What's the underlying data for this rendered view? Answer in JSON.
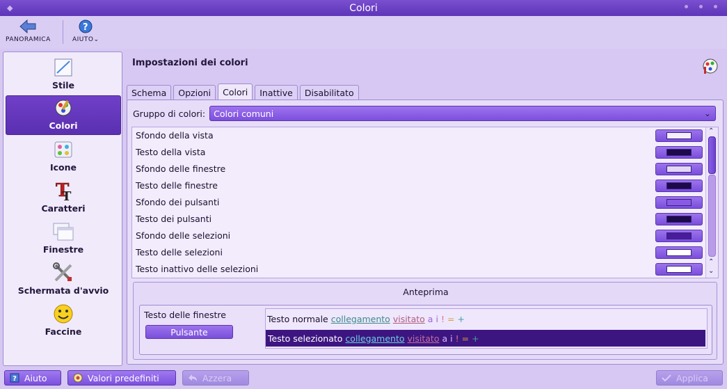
{
  "window": {
    "title": "Colori"
  },
  "toolbar": {
    "overview_label": "PANORAMICA",
    "help_label": "AIUTO"
  },
  "sidebar": {
    "items": [
      {
        "label": "Stile"
      },
      {
        "label": "Colori"
      },
      {
        "label": "Icone"
      },
      {
        "label": "Caratteri"
      },
      {
        "label": "Finestre"
      },
      {
        "label": "Schermata d'avvio"
      },
      {
        "label": "Faccine"
      }
    ]
  },
  "main": {
    "title": "Impostazioni dei colori",
    "tabs": [
      {
        "label": "Schema"
      },
      {
        "label": "Opzioni"
      },
      {
        "label": "Colori"
      },
      {
        "label": "Inattive"
      },
      {
        "label": "Disabilitato"
      }
    ],
    "group_label": "Gruppo di colori:",
    "group_value": "Colori comuni",
    "color_rows": [
      {
        "label": "Sfondo della vista",
        "color": "#f4eefd"
      },
      {
        "label": "Testo della vista",
        "color": "#1c0a4a"
      },
      {
        "label": "Sfondo delle finestre",
        "color": "#e2d8f6"
      },
      {
        "label": "Testo delle finestre",
        "color": "#1c0a4a"
      },
      {
        "label": "Sfondo dei pulsanti",
        "color": "#8a5ae6"
      },
      {
        "label": "Testo dei pulsanti",
        "color": "#1c0a4a"
      },
      {
        "label": "Sfondo delle selezioni",
        "color": "#4a1c9c"
      },
      {
        "label": "Testo delle selezioni",
        "color": "#ffffff"
      },
      {
        "label": "Testo inattivo delle selezioni",
        "color": "#ffffff"
      }
    ],
    "preview": {
      "title": "Anteprima",
      "window_text": "Testo delle finestre",
      "button_text": "Pulsante",
      "normal_text": "Testo normale",
      "selected_text": "Testo selezionato",
      "link": "collegamento",
      "visited": "visitato",
      "extra1": "a",
      "extra2": "i",
      "extra3": "!",
      "extra4": "=",
      "extra5": "+"
    }
  },
  "bottom": {
    "help": "Aiuto",
    "defaults": "Valori predefiniti",
    "reset": "Azzera",
    "apply": "Applica"
  }
}
